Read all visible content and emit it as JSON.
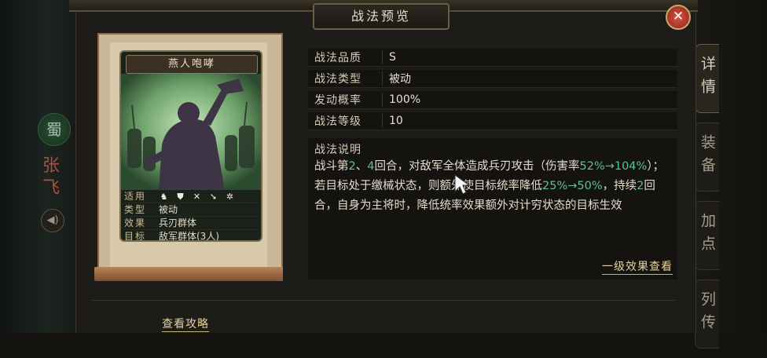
{
  "window": {
    "title": "战法预览"
  },
  "sidebar": {
    "faction_badge": "蜀",
    "general_name": "张飞",
    "sound_icon": "speaker-icon"
  },
  "tabs": [
    {
      "label": "详情",
      "active": true
    },
    {
      "label": "装备",
      "active": false
    },
    {
      "label": "加点",
      "active": false
    },
    {
      "label": "列传",
      "active": false
    }
  ],
  "card": {
    "name": "燕人咆哮",
    "rows": {
      "use": {
        "label": "适用",
        "icons": [
          "cavalry-icon",
          "shield-icon",
          "crossed-swords-icon",
          "spear-icon",
          "wheel-icon"
        ]
      },
      "type": {
        "label": "类型",
        "value": "被动"
      },
      "effect": {
        "label": "效果",
        "value": "兵刃群体"
      },
      "target": {
        "label": "目标",
        "value": "敌军群体(3人)"
      }
    }
  },
  "attributes": [
    {
      "label": "战法品质",
      "value": "S"
    },
    {
      "label": "战法类型",
      "value": "被动"
    },
    {
      "label": "发动概率",
      "value": "100%"
    },
    {
      "label": "战法等级",
      "value": "10"
    }
  ],
  "description": {
    "title": "战法说明",
    "parts": {
      "p1": "战斗第",
      "g1": "2",
      "p2": "、",
      "g2": "4",
      "p3": "回合，对敌军全体造成兵刃攻击（伤害率",
      "g3": "52%→104%",
      "p4": "）；若目标处于缴械状态，则额外使目标统率降低",
      "g4": "25%→50%",
      "p5": "，持续",
      "g5": "2",
      "p6": "回合，自身为主将时，降低统率效果额外对计穷状态的目标生效"
    },
    "level_link": "一级效果查看"
  },
  "footer": {
    "guide_link": "查看攻略"
  },
  "colors": {
    "highlight": "#5fbf95",
    "link": "#e6d29f",
    "close": "#c0392b"
  }
}
